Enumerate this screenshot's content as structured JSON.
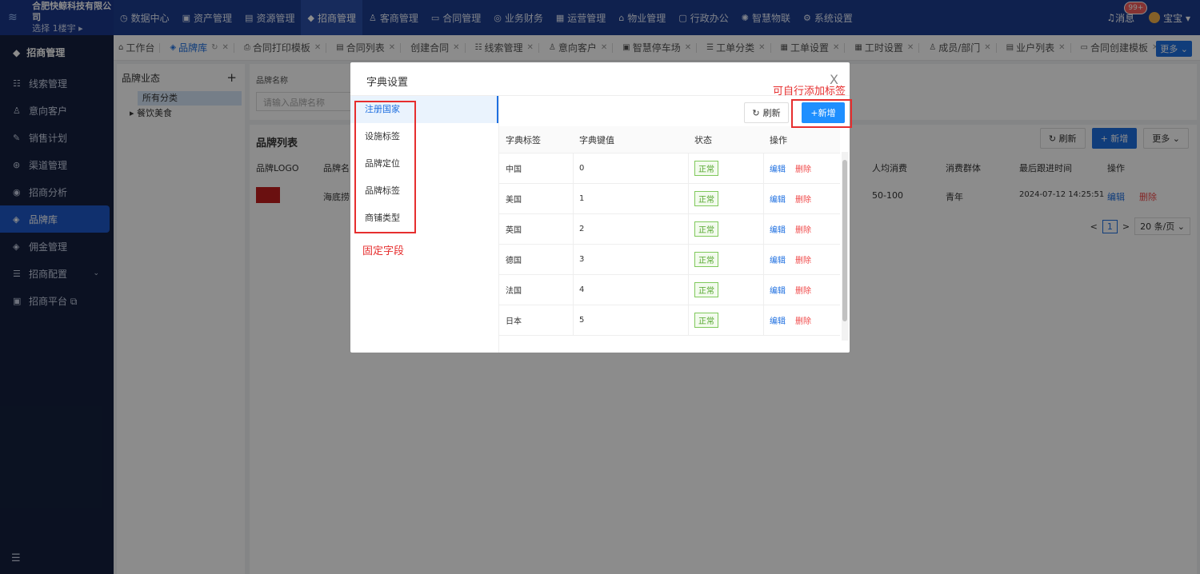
{
  "header": {
    "company": "合肥快鲸科技有限公司",
    "building": "选择 1楼宇 ▸",
    "nav": [
      {
        "label": "数据中心",
        "icon": "◷"
      },
      {
        "label": "资产管理",
        "icon": "▣"
      },
      {
        "label": "资源管理",
        "icon": "▤"
      },
      {
        "label": "招商管理",
        "icon": "◆"
      },
      {
        "label": "客商管理",
        "icon": "♙"
      },
      {
        "label": "合同管理",
        "icon": "▭"
      },
      {
        "label": "业务财务",
        "icon": "◎"
      },
      {
        "label": "运营管理",
        "icon": "▦"
      },
      {
        "label": "物业管理",
        "icon": "⌂"
      },
      {
        "label": "行政办公",
        "icon": "▢"
      },
      {
        "label": "智慧物联",
        "icon": "✺"
      },
      {
        "label": "系统设置",
        "icon": "⚙"
      }
    ],
    "active_nav": "招商管理",
    "messages_label": "消息",
    "messages_badge": "99+",
    "user_name": "宝宝 ▾"
  },
  "sidebar": {
    "title": "招商管理",
    "items": [
      {
        "label": "线索管理",
        "icon": "☷"
      },
      {
        "label": "意向客户",
        "icon": "♙"
      },
      {
        "label": "销售计划",
        "icon": "✎"
      },
      {
        "label": "渠道管理",
        "icon": "⊛"
      },
      {
        "label": "招商分析",
        "icon": "◉"
      },
      {
        "label": "品牌库",
        "icon": "◈"
      },
      {
        "label": "佣金管理",
        "icon": "◈"
      },
      {
        "label": "招商配置",
        "icon": "☰",
        "caret": "⌄"
      },
      {
        "label": "招商平台 ⧉",
        "icon": "▣"
      }
    ],
    "active": "品牌库",
    "collapse_icon": "☰"
  },
  "tabs": [
    {
      "label": "工作台",
      "icon": "⌂",
      "closable": false
    },
    {
      "label": "品牌库",
      "icon": "◈",
      "closable": true,
      "active": true,
      "extra": "↻"
    },
    {
      "label": "合同打印模板",
      "icon": "⎙",
      "closable": true
    },
    {
      "label": "合同列表",
      "icon": "▤",
      "closable": true
    },
    {
      "label": "创建合同",
      "icon": "",
      "closable": true
    },
    {
      "label": "线索管理",
      "icon": "☷",
      "closable": true
    },
    {
      "label": "意向客户",
      "icon": "♙",
      "closable": true
    },
    {
      "label": "智慧停车场",
      "icon": "▣",
      "closable": true
    },
    {
      "label": "工单分类",
      "icon": "☰",
      "closable": true
    },
    {
      "label": "工单设置",
      "icon": "▦",
      "closable": true
    },
    {
      "label": "工时设置",
      "icon": "▦",
      "closable": true
    },
    {
      "label": "成员/部门",
      "icon": "♙",
      "closable": true
    },
    {
      "label": "业户列表",
      "icon": "▤",
      "closable": true
    },
    {
      "label": "合同创建模板",
      "icon": "▭",
      "closable": true
    }
  ],
  "tabs_more": "更多 ⌄",
  "tree": {
    "title": "品牌业态",
    "add": "+",
    "selected": "所有分类",
    "node": "▸ 餐饮美食"
  },
  "filter": {
    "label": "品牌名称",
    "placeholder": "请输入品牌名称"
  },
  "list": {
    "title": "品牌列表",
    "refresh": "刷新",
    "add": "+ 新增",
    "more": "更多 ⌄",
    "headers": {
      "logo": "品牌LOGO",
      "name": "品牌名",
      "avg": "人均消费",
      "group": "消费群体",
      "last": "最后跟进时间",
      "ops": "操作"
    },
    "row": {
      "name": "海底捞",
      "avg": "50-100",
      "group": "青年",
      "last": "2024-07-12 14:25:51",
      "edit": "编辑",
      "del": "删除"
    },
    "pager": {
      "prev": "<",
      "page": "1",
      "next": ">",
      "size": "20 条/页 ⌄"
    }
  },
  "modal": {
    "title": "字典设置",
    "close": "X",
    "menu": [
      "注册国家",
      "设施标签",
      "品牌定位",
      "品牌标签",
      "商铺类型"
    ],
    "active": "注册国家",
    "refresh": "刷新",
    "add": "+新增",
    "headers": [
      "字典标签",
      "字典键值",
      "状态",
      "操作"
    ],
    "rows": [
      {
        "label": "中国",
        "value": "0",
        "status": "正常"
      },
      {
        "label": "美国",
        "value": "1",
        "status": "正常"
      },
      {
        "label": "英国",
        "value": "2",
        "status": "正常"
      },
      {
        "label": "德国",
        "value": "3",
        "status": "正常"
      },
      {
        "label": "法国",
        "value": "4",
        "status": "正常"
      },
      {
        "label": "日本",
        "value": "5",
        "status": "正常"
      }
    ],
    "edit": "编辑",
    "delete": "删除"
  },
  "annotations": {
    "fixed_fields": "固定字段",
    "custom_tags": "可自行添加标签"
  },
  "colors": {
    "primary": "#1e6fe0",
    "topbar": "#1c3d8f",
    "sidebar": "#14203e",
    "annotation": "#e62e2e"
  }
}
